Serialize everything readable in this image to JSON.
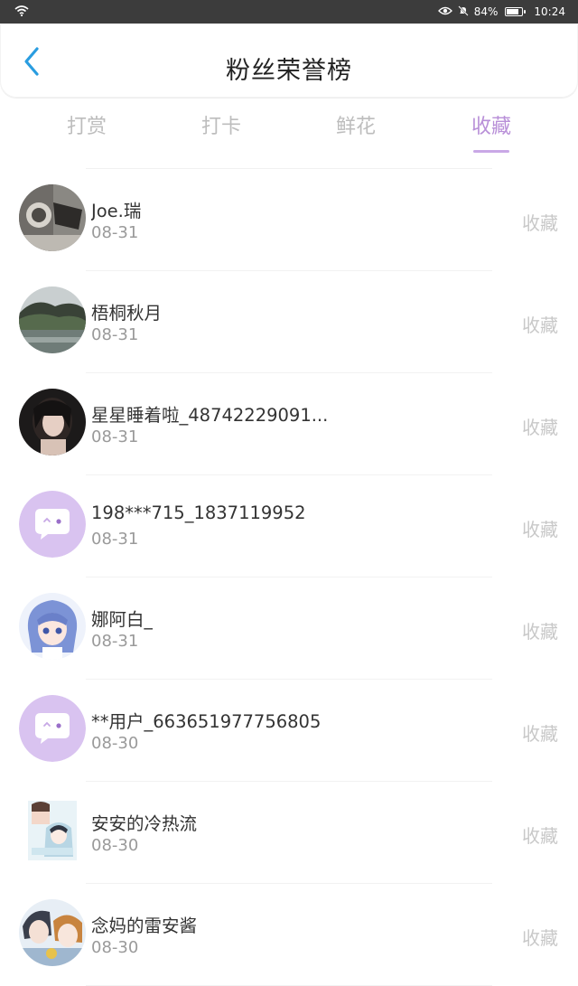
{
  "status": {
    "battery": "84%",
    "time": "10:24",
    "battery_level": 0.84
  },
  "header": {
    "title": "粉丝荣誉榜"
  },
  "tabs": [
    {
      "label": "打赏"
    },
    {
      "label": "打卡"
    },
    {
      "label": "鲜花"
    },
    {
      "label": "收藏"
    }
  ],
  "active_tab": 3,
  "colors": {
    "accent": "#b88fd8",
    "back": "#2a9de0",
    "placeholder_avatar": "#d9c3f0"
  },
  "fans": [
    {
      "name": "Joe.瑞",
      "date": "08-31",
      "action": "收藏",
      "avatar": "photo-avatar-icon"
    },
    {
      "name": "梧桐秋月",
      "date": "08-31",
      "action": "收藏",
      "avatar": "landscape-avatar-icon"
    },
    {
      "name": "星星睡着啦_48742229091...",
      "date": "08-31",
      "action": "收藏",
      "avatar": "portrait-avatar-icon"
    },
    {
      "name": "198***715_1837119952",
      "date": "08-31",
      "action": "收藏",
      "avatar": "chat-bubble-avatar-icon"
    },
    {
      "name": "娜阿白_",
      "date": "08-31",
      "action": "收藏",
      "avatar": "anime-avatar-icon"
    },
    {
      "name": "**用户_663651977756805",
      "date": "08-30",
      "action": "收藏",
      "avatar": "chat-bubble-avatar-icon"
    },
    {
      "name": "安安的冷热流",
      "date": "08-30",
      "action": "收藏",
      "avatar": "anime-avatar-icon"
    },
    {
      "name": "念妈的雷安酱",
      "date": "08-30",
      "action": "收藏",
      "avatar": "anime-avatar-icon"
    }
  ]
}
